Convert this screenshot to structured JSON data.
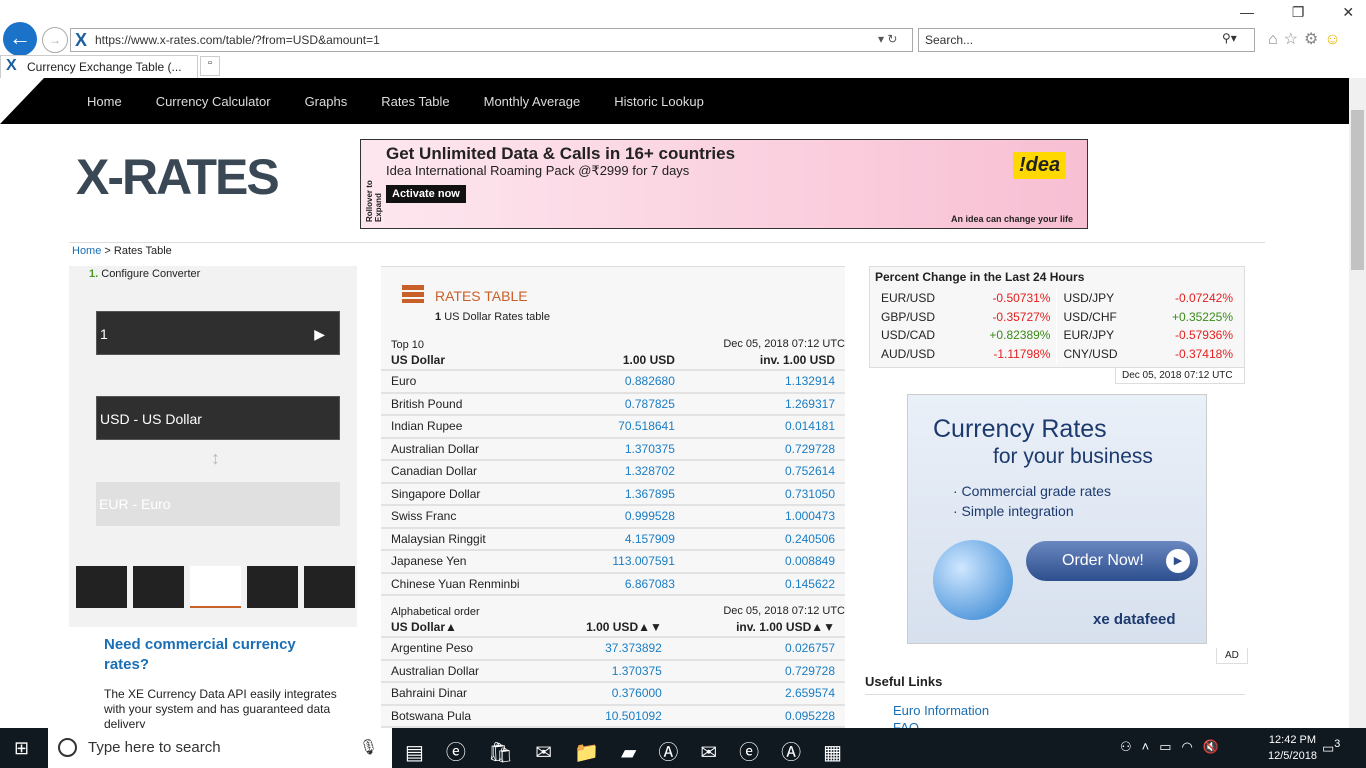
{
  "browser": {
    "url": "https://www.x-rates.com/table/?from=USD&amount=1",
    "search_placeholder": "Search...",
    "tab_title": "Currency Exchange Table (..."
  },
  "nav": [
    "Home",
    "Currency Calculator",
    "Graphs",
    "Rates Table",
    "Monthly Average",
    "Historic Lookup"
  ],
  "logo": "X-RATES",
  "ad": {
    "headline": "Get Unlimited Data & Calls in 16+ countries",
    "sub": "Idea International Roaming Pack @₹2999 for 7 days",
    "cta": "Activate now",
    "side": "Rollover to Expand",
    "brand": "!dea",
    "tagline": "An idea can change your life"
  },
  "breadcrumb": {
    "home": "Home",
    "current": "> Rates Table"
  },
  "converter": {
    "step_num": "1.",
    "step": "Configure Converter",
    "amount": "1",
    "from": "USD - US Dollar",
    "to": "EUR - Euro"
  },
  "promo": {
    "title": "Need commercial currency rates?",
    "body": "The XE Currency Data API easily integrates with your system and has guaranteed data delivery"
  },
  "rates": {
    "title": "RATES TABLE",
    "amount": "1",
    "subtitle": "US Dollar Rates table",
    "top": {
      "label": "Top 10",
      "date": "Dec 05, 2018 07:12 UTC",
      "col0": "US Dollar",
      "col1": "1.00 USD",
      "col2": "inv. 1.00 USD",
      "rows": [
        [
          "Euro",
          "0.882680",
          "1.132914"
        ],
        [
          "British Pound",
          "0.787825",
          "1.269317"
        ],
        [
          "Indian Rupee",
          "70.518641",
          "0.014181"
        ],
        [
          "Australian Dollar",
          "1.370375",
          "0.729728"
        ],
        [
          "Canadian Dollar",
          "1.328702",
          "0.752614"
        ],
        [
          "Singapore Dollar",
          "1.367895",
          "0.731050"
        ],
        [
          "Swiss Franc",
          "0.999528",
          "1.000473"
        ],
        [
          "Malaysian Ringgit",
          "4.157909",
          "0.240506"
        ],
        [
          "Japanese Yen",
          "113.007591",
          "0.008849"
        ],
        [
          "Chinese Yuan Renminbi",
          "6.867083",
          "0.145622"
        ]
      ]
    },
    "alpha": {
      "label": "Alphabetical order",
      "date": "Dec 05, 2018 07:12 UTC",
      "col0": "US Dollar▲",
      "col1": "1.00 USD▲▼",
      "col2": "inv. 1.00 USD▲▼",
      "rows": [
        [
          "Argentine Peso",
          "37.373892",
          "0.026757"
        ],
        [
          "Australian Dollar",
          "1.370375",
          "0.729728"
        ],
        [
          "Bahraini Dinar",
          "0.376000",
          "2.659574"
        ],
        [
          "Botswana Pula",
          "10.501092",
          "0.095228"
        ]
      ]
    }
  },
  "percent": {
    "title": "Percent Change in the Last 24 Hours",
    "date": "Dec 05, 2018 07:12 UTC",
    "rows": [
      [
        "EUR/USD",
        "-0.50731%",
        "USD/JPY",
        "-0.07242%"
      ],
      [
        "GBP/USD",
        "-0.35727%",
        "USD/CHF",
        "+0.35225%"
      ],
      [
        "USD/CAD",
        "+0.82389%",
        "EUR/JPY",
        "-0.57936%"
      ],
      [
        "AUD/USD",
        "-1.11798%",
        "CNY/USD",
        "-0.37418%"
      ]
    ]
  },
  "xe_ad": {
    "title1": "Currency Rates",
    "title2": "for your business",
    "b1": "· Commercial grade rates",
    "b2": "· Simple integration",
    "cta": "Order Now!",
    "brand": "xe datafeed",
    "ad_label": "AD"
  },
  "useful": {
    "title": "Useful Links",
    "links": [
      "Euro Information",
      "FAQ"
    ]
  },
  "taskbar": {
    "search": "Type here to search",
    "time": "12:42 PM",
    "date": "12/5/2018",
    "notifications": "3"
  }
}
